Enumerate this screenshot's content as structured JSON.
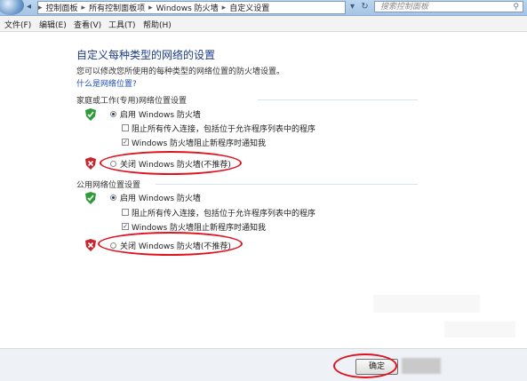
{
  "addressbar": {
    "crumbs": [
      "控制面板",
      "所有控制面板项",
      "Windows 防火墙",
      "自定义设置"
    ],
    "separator": "▸"
  },
  "search": {
    "placeholder": "搜索控制面板"
  },
  "menu": [
    "文件(F)",
    "编辑(E)",
    "查看(V)",
    "工具(T)",
    "帮助(H)"
  ],
  "page": {
    "heading": "自定义每种类型的网络的设置",
    "description": "您可以修改您所使用的每种类型的网络位置的防火墙设置。",
    "link": "什么是网络位置?"
  },
  "home": {
    "title": "家庭或工作(专用)网络位置设置",
    "enable": "启用 Windows 防火墙",
    "block_all": "阻止所有传入连接，包括位于允许程序列表中的程序",
    "notify": "Windows 防火墙阻止新程序时通知我",
    "disable": "关闭 Windows 防火墙(不推荐)"
  },
  "public": {
    "title": "公用网络位置设置",
    "enable": "启用 Windows 防火墙",
    "block_all": "阻止所有传入连接，包括位于允许程序列表中的程序",
    "notify": "Windows 防火墙阻止新程序时通知我",
    "disable": "关闭 Windows 防火墙(不推荐)"
  },
  "buttons": {
    "ok": "确定"
  },
  "colors": {
    "annotation": "#e0121f",
    "link": "#1f4fb7",
    "heading": "#1b3b8b"
  }
}
